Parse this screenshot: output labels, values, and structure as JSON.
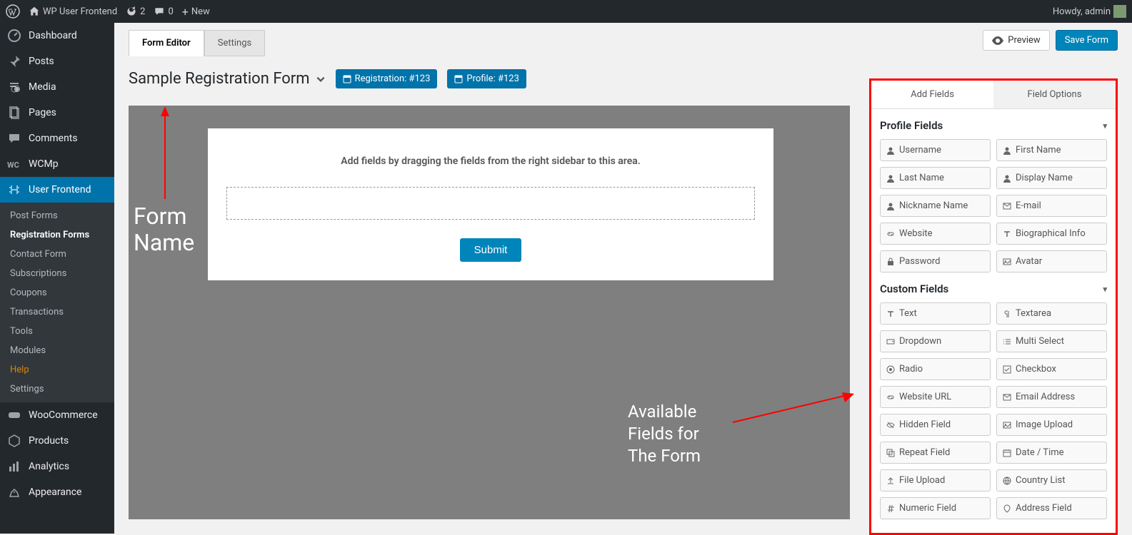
{
  "adminbar": {
    "site_name": "WP User Frontend",
    "updates_count": "2",
    "comments_count": "0",
    "new_label": "New",
    "howdy": "Howdy, admin"
  },
  "sidebar": {
    "items": [
      {
        "icon": "dashboard",
        "label": "Dashboard"
      },
      {
        "icon": "pin",
        "label": "Posts"
      },
      {
        "icon": "media",
        "label": "Media"
      },
      {
        "icon": "page",
        "label": "Pages"
      },
      {
        "icon": "comment",
        "label": "Comments"
      },
      {
        "icon": "wcmp",
        "label": "WCMp"
      },
      {
        "icon": "userfront",
        "label": "User Frontend",
        "active": true
      },
      {
        "icon": "woo",
        "label": "WooCommerce"
      },
      {
        "icon": "products",
        "label": "Products"
      },
      {
        "icon": "analytics",
        "label": "Analytics"
      },
      {
        "icon": "appearance",
        "label": "Appearance"
      }
    ],
    "submenu": [
      {
        "label": "Post Forms"
      },
      {
        "label": "Registration Forms",
        "current": true
      },
      {
        "label": "Contact Form"
      },
      {
        "label": "Subscriptions"
      },
      {
        "label": "Coupons"
      },
      {
        "label": "Transactions"
      },
      {
        "label": "Tools"
      },
      {
        "label": "Modules"
      },
      {
        "label": "Help",
        "help": true
      },
      {
        "label": "Settings"
      }
    ]
  },
  "tabs": {
    "editor": "Form Editor",
    "settings": "Settings"
  },
  "top": {
    "preview": "Preview",
    "save": "Save Form"
  },
  "form": {
    "title": "Sample Registration Form",
    "reg_badge": "Registration: #123",
    "profile_badge": "Profile: #123",
    "hint": "Add fields by dragging the fields from the right sidebar to this area.",
    "submit": "Submit"
  },
  "annot": {
    "form_name": "Form\nName",
    "avail": "Available\nFields for\nThe Form"
  },
  "right": {
    "tab1": "Add Fields",
    "tab2": "Field Options",
    "sec1": "Profile Fields",
    "sec2": "Custom Fields",
    "profile_fields": [
      {
        "i": "user",
        "l": "Username"
      },
      {
        "i": "user",
        "l": "First Name"
      },
      {
        "i": "user",
        "l": "Last Name"
      },
      {
        "i": "user",
        "l": "Display Name"
      },
      {
        "i": "user",
        "l": "Nickname Name"
      },
      {
        "i": "mail",
        "l": "E-mail"
      },
      {
        "i": "link",
        "l": "Website"
      },
      {
        "i": "text",
        "l": "Biographical Info"
      },
      {
        "i": "lock",
        "l": "Password"
      },
      {
        "i": "img",
        "l": "Avatar"
      }
    ],
    "custom_fields": [
      {
        "i": "text",
        "l": "Text"
      },
      {
        "i": "para",
        "l": "Textarea"
      },
      {
        "i": "drop",
        "l": "Dropdown"
      },
      {
        "i": "list",
        "l": "Multi Select"
      },
      {
        "i": "radio",
        "l": "Radio"
      },
      {
        "i": "check",
        "l": "Checkbox"
      },
      {
        "i": "link",
        "l": "Website URL"
      },
      {
        "i": "mail",
        "l": "Email Address"
      },
      {
        "i": "eye",
        "l": "Hidden Field"
      },
      {
        "i": "img",
        "l": "Image Upload"
      },
      {
        "i": "repeat",
        "l": "Repeat Field"
      },
      {
        "i": "cal",
        "l": "Date / Time"
      },
      {
        "i": "upload",
        "l": "File Upload"
      },
      {
        "i": "globe",
        "l": "Country List"
      },
      {
        "i": "hash",
        "l": "Numeric Field"
      },
      {
        "i": "addr",
        "l": "Address Field"
      }
    ]
  }
}
